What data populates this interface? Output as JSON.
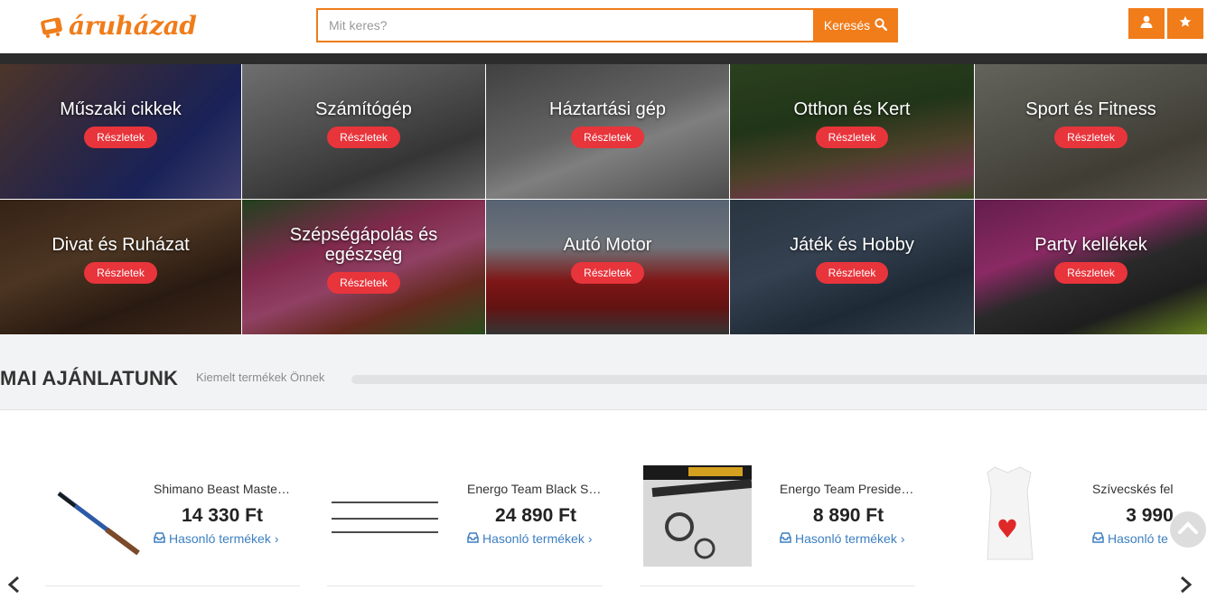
{
  "brand": {
    "logo_text": "áruházad",
    "accent": "#f07c1a"
  },
  "search": {
    "placeholder": "Mit keres?",
    "button_label": "Keresés"
  },
  "header_buttons": {
    "user_icon": "user-icon",
    "favorites_icon": "star-icon"
  },
  "categories": [
    {
      "title": "Műszaki cikkek",
      "button": "Részletek"
    },
    {
      "title": "Számítógép",
      "button": "Részletek"
    },
    {
      "title": "Háztartási gép",
      "button": "Részletek"
    },
    {
      "title": "Otthon és Kert",
      "button": "Részletek"
    },
    {
      "title": "Sport és Fitness",
      "button": "Részletek"
    },
    {
      "title": "Divat és Ruházat",
      "button": "Részletek"
    },
    {
      "title": "Szépségápolás és egészség",
      "button": "Részletek"
    },
    {
      "title": "Autó Motor",
      "button": "Részletek"
    },
    {
      "title": "Játék és Hobby",
      "button": "Részletek"
    },
    {
      "title": "Party kellékek",
      "button": "Részletek"
    }
  ],
  "section": {
    "title": "MAI AJÁNLATUNK",
    "subtitle": "Kiemelt termékek Önnek"
  },
  "products": [
    {
      "name": "Shimano Beast Maste…",
      "price": "14 330 Ft",
      "link": "Hasonló termékek"
    },
    {
      "name": "Energo Team Black Sp…",
      "price": "24 890 Ft",
      "link": "Hasonló termékek"
    },
    {
      "name": "Energo Team Presiden…",
      "price": "8 890 Ft",
      "link": "Hasonló termékek"
    },
    {
      "name": "Szívecskés fel",
      "price": "3 990",
      "link": "Hasonló te"
    }
  ]
}
